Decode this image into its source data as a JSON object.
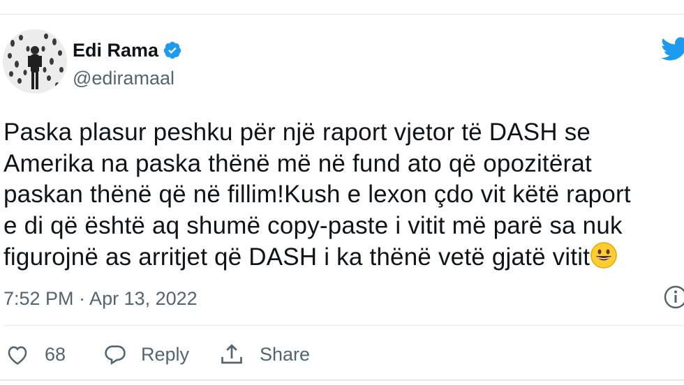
{
  "author": {
    "name": "Edi Rama",
    "handle": "@ediramaal",
    "verified": true
  },
  "tweet": {
    "lines": [
      "Paska plasur peshku për një raport vjetor të DASH se",
      "Amerika na paska thënë më në fund ato që opozitërat",
      "paskan thënë që në fillim!Kush e lexon çdo vit këtë raport",
      "e di që është aq shumë copy-paste i vitit më parë sa nuk",
      "figurojnë as arritjet që DASH i ka thënë vetë gjatë vitit"
    ],
    "emoji": "smiling-face-emoji",
    "timestamp": "7:52 PM · Apr 13, 2022"
  },
  "actions": {
    "like_count": "68",
    "reply_label": "Reply",
    "share_label": "Share"
  },
  "icons": {
    "logo": "twitter-bird-icon",
    "verified": "verified-badge-icon",
    "info": "info-icon",
    "like": "heart-icon",
    "reply": "reply-bubble-icon",
    "share": "share-icon"
  },
  "colors": {
    "brand_blue": "#1d9bf0",
    "text_primary": "#0f1419",
    "text_secondary": "#536471",
    "border": "#e7e9eb"
  }
}
